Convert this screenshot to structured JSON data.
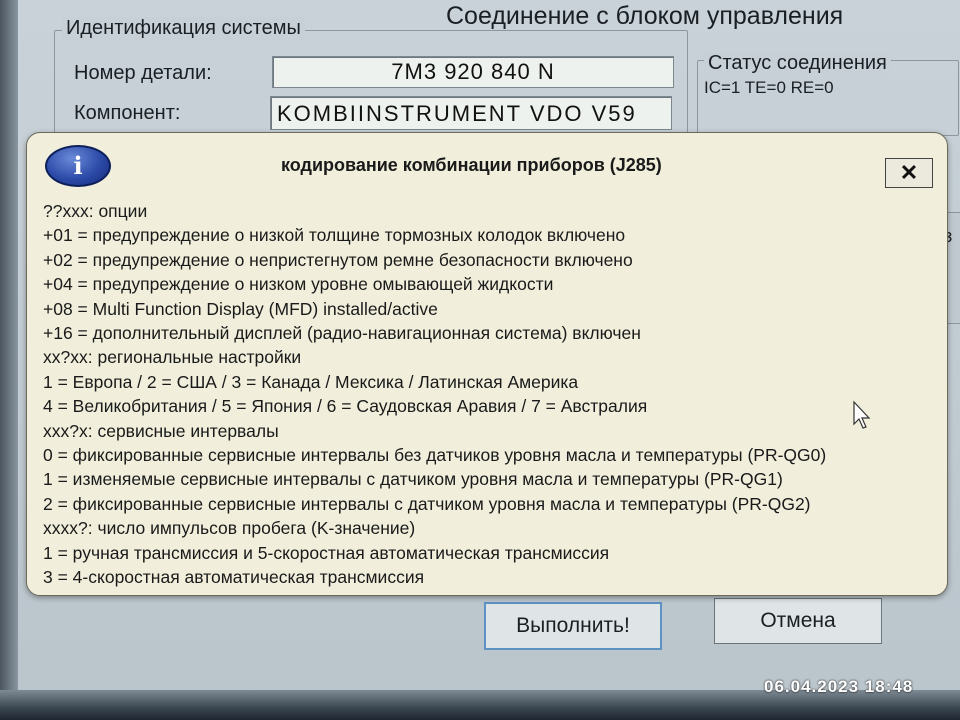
{
  "window": {
    "title": "Соединение с блоком управления"
  },
  "identification": {
    "legend": "Идентификация системы",
    "part_number_label": "Номер детали:",
    "part_number_value": "7M3 920 840 N",
    "component_label": "Компонент:",
    "component_value": "KOMBIINSTRUMENT VDO V59"
  },
  "connection_status": {
    "legend": "Статус соединения",
    "values": "IC=1  TE=0   RE=0"
  },
  "buttons": {
    "execute_label": "Выполнить!",
    "cancel_label": "Отмена"
  },
  "background_partial_text": "з",
  "dialog": {
    "title": "кодирование комбинации приборов (J285)",
    "icon": "info-icon",
    "close_label": "✕",
    "lines": [
      "??xxx: опции",
      "+01 = предупреждение о низкой толщине тормозных колодок включено",
      "+02 = предупреждение о непристегнутом ремне безопасности включено",
      "+04 = предупреждение о низком уровне омывающей жидкости",
      "+08 = Multi Function Display (MFD) installed/active",
      "+16 = дополнительный дисплей (радио-навигационная система) включен",
      "xx?xx: региональные настройки",
      "1 = Европа / 2 = США / 3 = Канада / Мексика / Латинская Америка",
      "4 = Великобритания / 5 = Япония / 6 = Саудовская Аравия / 7 = Австралия",
      "xxx?x: сервисные интервалы",
      "0 = фиксированные сервисные интервалы без датчиков уровня масла и температуры (PR-QG0)",
      "1 = изменяемые сервисные интервалы с датчиком уровня масла и температуры (PR-QG1)",
      "2 = фиксированные сервисные интервалы с датчиком уровня масла и температуры (PR-QG2)",
      "xxxx?: число импульсов пробега (K-значение)",
      "1 = ручная трансмиссия и 5-скоростная автоматическая трансмиссия",
      "3 = 4-скоростная автоматическая трансмиссия"
    ]
  },
  "photo_timestamp": "06.04.2023  18:48"
}
